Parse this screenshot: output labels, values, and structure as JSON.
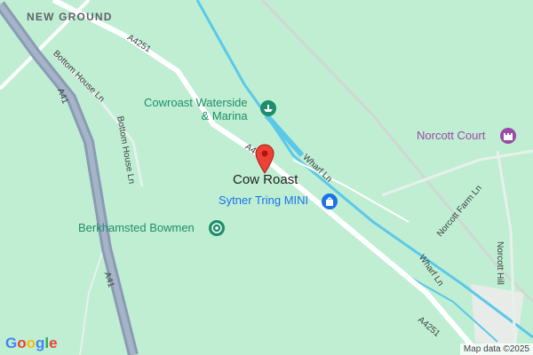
{
  "map": {
    "places": {
      "new_ground": "NEW GROUND",
      "cow_roast": "Cow Roast"
    },
    "pois": {
      "marina": [
        "Cowroast Waterside",
        "& Marina"
      ],
      "sytner": "Sytner Tring MINI",
      "bowmen": "Berkhamsted Bowmen",
      "norcott_court": "Norcott Court"
    },
    "roads": {
      "a4251_top": "A4251",
      "a4251_center": "A4",
      "a4251_bottom": "A4251",
      "a41_top": "A41",
      "a41_bottom": "A41",
      "bottom_house_1": "Bottom House Ln",
      "bottom_house_2": "Bottom House Ln",
      "wharf_1": "Wharf Ln",
      "wharf_2": "Wharf Ln",
      "norcott_farm": "Norcott Farm Ln",
      "norcott_hill": "Norcott Hill"
    },
    "attribution": "Map data ©2025",
    "logo": "Google",
    "colors": {
      "land": "#bfeed3",
      "motorway": "#8a9bb4",
      "minor_road": "#ffffff",
      "water": "#5cc8e8",
      "marker": "#ea4335"
    },
    "icons": {
      "marina": "boat-icon",
      "sytner": "shopping-bag-icon",
      "bowmen": "target-icon",
      "norcott_court": "castle-icon",
      "pin": "location-pin-icon"
    }
  }
}
